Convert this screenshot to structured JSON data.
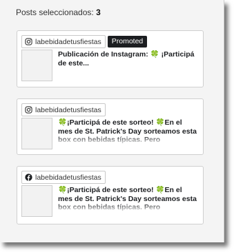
{
  "selection": {
    "label": "Posts seleccionados:",
    "count": "3"
  },
  "posts": [
    {
      "platform_icon": "instagram-icon",
      "account": "labebidadetusfiestas",
      "badge": "Promoted",
      "text": "Publicación de Instagram: 🍀 ¡Participá de este..."
    },
    {
      "platform_icon": "instagram-icon",
      "account": "labebidadetusfiestas",
      "text": "🍀¡Participá de este sorteo! 🍀En el mes de St. Patrick's Day sorteamos esta box con bebidas típicas. Pero"
    },
    {
      "platform_icon": "facebook-icon",
      "account": "labebidadetusfiestas",
      "text": "🍀¡Participá de este sorteo! 🍀En el mes de St. Patrick's Day sorteamos esta box con bebidas típicas. Pero"
    }
  ]
}
